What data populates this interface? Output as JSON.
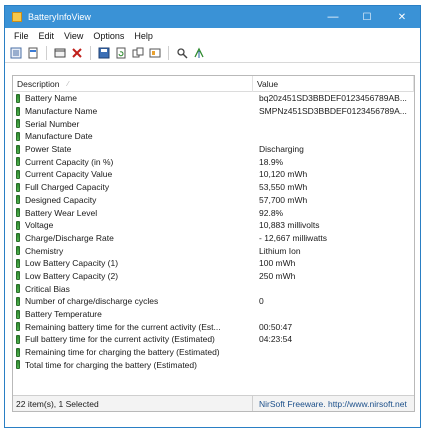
{
  "window": {
    "title": "BatteryInfoView",
    "min_glyph": "—",
    "max_glyph": "☐",
    "close_glyph": "✕"
  },
  "menu": [
    "File",
    "Edit",
    "View",
    "Options",
    "Help"
  ],
  "columns": {
    "description": "Description",
    "value": "Value"
  },
  "rows": [
    {
      "label": "Battery Name",
      "value": "bq20z451SD3BBDEF0123456789AB..."
    },
    {
      "label": "Manufacture Name",
      "value": "SMPNz451SD3BBDEF0123456789A..."
    },
    {
      "label": "Serial Number",
      "value": ""
    },
    {
      "label": "Manufacture Date",
      "value": ""
    },
    {
      "label": "Power State",
      "value": "Discharging"
    },
    {
      "label": "Current Capacity (in %)",
      "value": "18.9%"
    },
    {
      "label": "Current Capacity Value",
      "value": "10,120 mWh"
    },
    {
      "label": "Full Charged Capacity",
      "value": "53,550 mWh"
    },
    {
      "label": "Designed Capacity",
      "value": "57,700 mWh"
    },
    {
      "label": "Battery Wear Level",
      "value": "92.8%"
    },
    {
      "label": "Voltage",
      "value": "10,883 millivolts"
    },
    {
      "label": "Charge/Discharge Rate",
      "value": "- 12,667 milliwatts"
    },
    {
      "label": "Chemistry",
      "value": "Lithium Ion"
    },
    {
      "label": "Low Battery Capacity (1)",
      "value": "100 mWh"
    },
    {
      "label": "Low Battery Capacity (2)",
      "value": "250 mWh"
    },
    {
      "label": "Critical Bias",
      "value": ""
    },
    {
      "label": "Number of charge/discharge cycles",
      "value": "0"
    },
    {
      "label": "Battery Temperature",
      "value": ""
    },
    {
      "label": "Remaining battery time for the current activity (Est...",
      "value": "00:50:47"
    },
    {
      "label": "Full battery time for the current activity (Estimated)",
      "value": "04:23:54"
    },
    {
      "label": "Remaining time for charging the battery (Estimated)",
      "value": ""
    },
    {
      "label": "Total  time for charging the battery (Estimated)",
      "value": ""
    }
  ],
  "status": {
    "left": "22 item(s), 1 Selected",
    "right": "NirSoft Freeware.  http://www.nirsoft.net"
  },
  "colors": {
    "titlebar": "#3a92d6",
    "battery_icon": "#3f9e3f"
  },
  "icons": {
    "toolbar": [
      "properties-icon",
      "html-report-icon",
      "delete-icon",
      "close-icon",
      "save-icon",
      "copy-icon",
      "refresh-icon",
      "options-icon",
      "find-icon",
      "exit-icon"
    ]
  }
}
